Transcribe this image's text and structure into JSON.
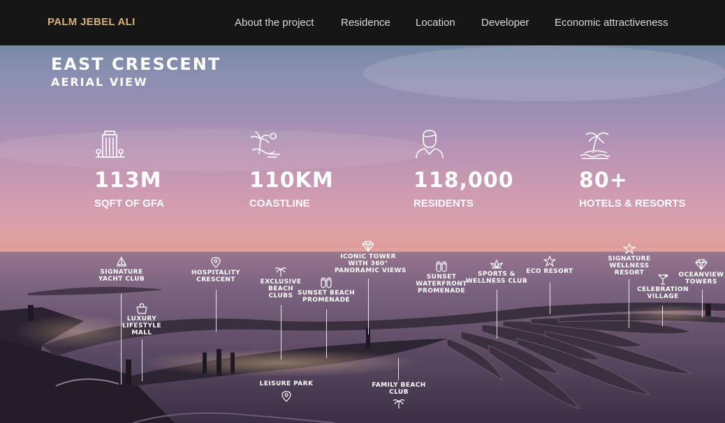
{
  "header": {
    "logo": "PALM JEBEL ALI",
    "nav": [
      "About the project",
      "Residence",
      "Location",
      "Developer",
      "Economic attractiveness"
    ]
  },
  "hero": {
    "title": "EAST CRESCENT",
    "subtitle": "AERIAL VIEW",
    "stats": [
      {
        "icon": "building-icon",
        "value": "113M",
        "label": "SQFT OF GFA"
      },
      {
        "icon": "coastline-icon",
        "value": "110KM",
        "label": "COASTLINE"
      },
      {
        "icon": "resident-icon",
        "value": "118,000",
        "label": "RESIDENTS"
      },
      {
        "icon": "palm-island-icon",
        "value": "80+",
        "label": "HOTELS & RESORTS"
      }
    ],
    "pois": [
      {
        "icon": "sailboat-icon",
        "label": "SIGNATURE\nYACHT CLUB"
      },
      {
        "icon": "shopping-bag-icon",
        "label": "LUXURY\nLIFESTYLE\nMALL"
      },
      {
        "icon": "map-pin-icon",
        "label": "HOSPITALITY\nCRESCENT"
      },
      {
        "icon": "palm-tree-icon",
        "label": "EXCLUSIVE\nBEACH\nCLUBS"
      },
      {
        "icon": "flip-flops-icon",
        "label": "SUNSET BEACH\nPROMENADE"
      },
      {
        "icon": "diamond-icon",
        "label": "ICONIC TOWER\nWITH 360°\nPANORAMIC VIEWS"
      },
      {
        "icon": "flip-flops-icon",
        "label": "SUNSET\nWATERFRONT\nPROMENADE"
      },
      {
        "icon": "lotus-icon",
        "label": "SPORTS &\nWELLNESS CLUB"
      },
      {
        "icon": "star-icon",
        "label": "ECO RESORT"
      },
      {
        "icon": "star-icon",
        "label": "SIGNATURE\nWELLNESS\nRESORT"
      },
      {
        "icon": "cocktail-icon",
        "label": "CELEBRATION\nVILLAGE"
      },
      {
        "icon": "diamond-icon",
        "label": "OCEANVIEW\nTOWERS"
      },
      {
        "icon": "map-pin-icon",
        "label": "LEISURE PARK"
      },
      {
        "icon": "palm-tree-icon",
        "label": "FAMILY BEACH\nCLUB"
      }
    ]
  },
  "colors": {
    "logo": "#d6b07a",
    "header_bg": "#161616",
    "text": "#ffffff"
  }
}
